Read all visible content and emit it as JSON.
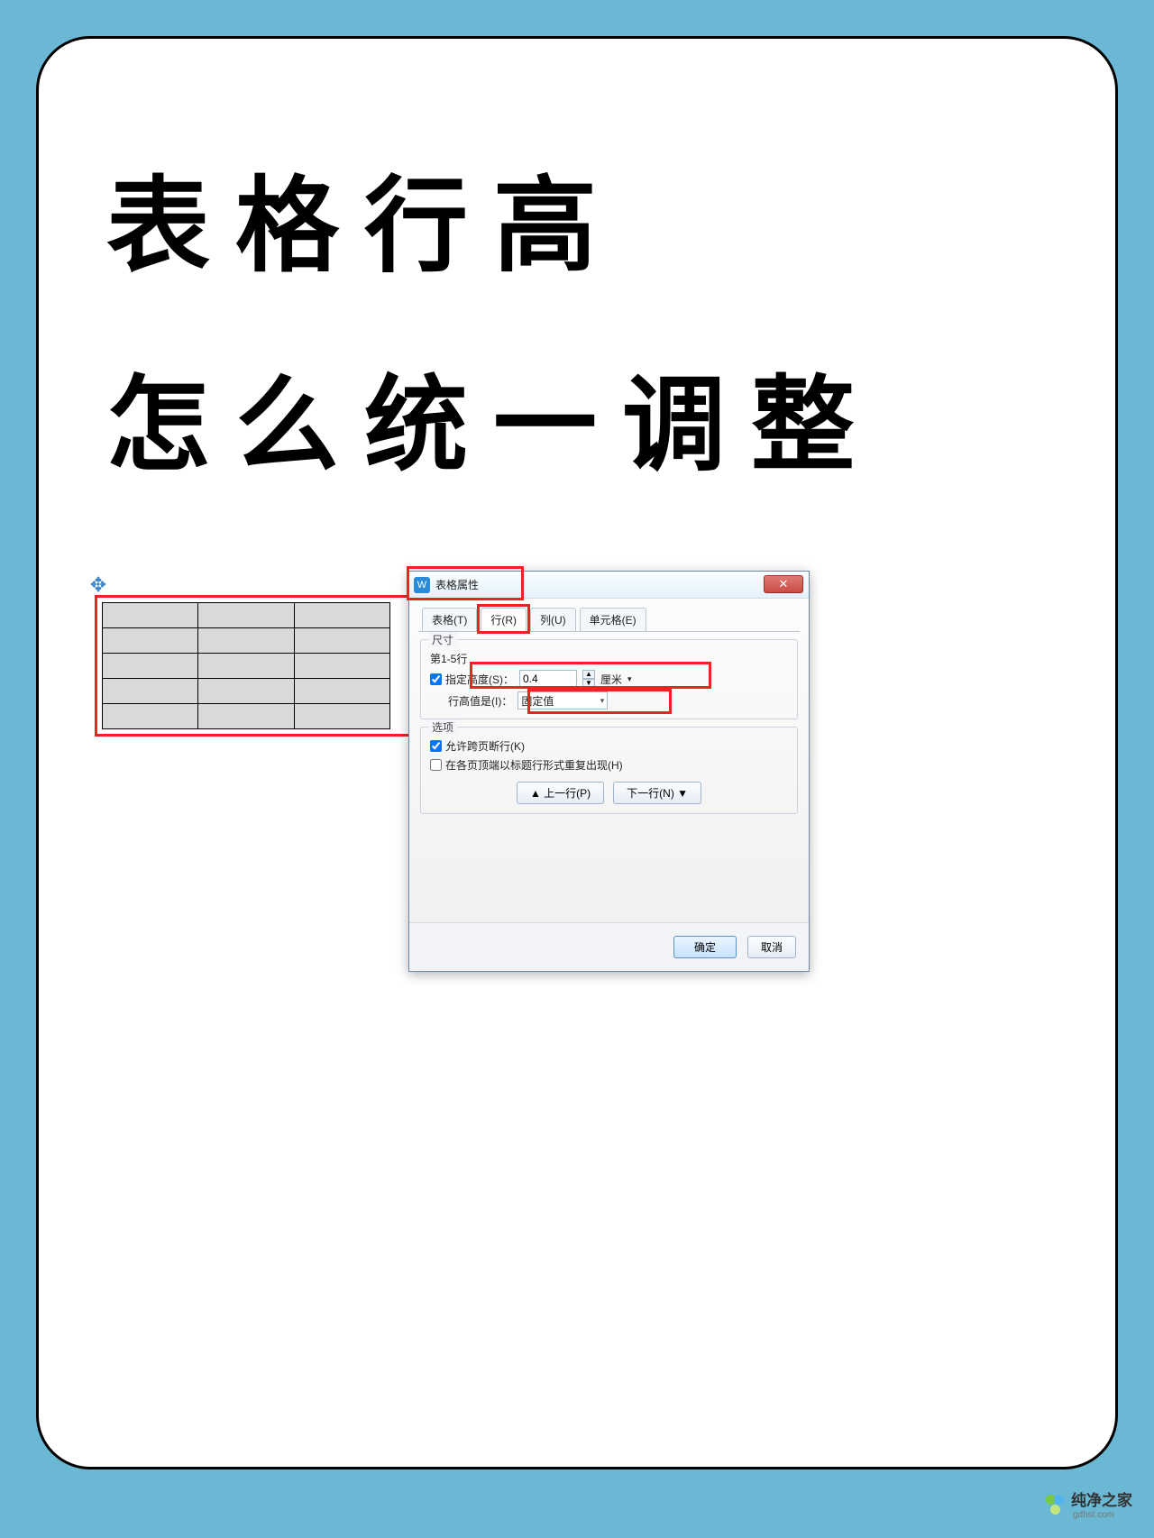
{
  "title": {
    "line1": "表格行高",
    "line2": "怎么统一调整"
  },
  "dialog": {
    "title": "表格属性",
    "close": "✕",
    "tabs": {
      "table": "表格(T)",
      "row": "行(R)",
      "column": "列(U)",
      "cell": "单元格(E)"
    },
    "size": {
      "group": "尺寸",
      "range": "第1-5行",
      "specify_label": "指定高度(S)：",
      "height_value": "0.4",
      "unit": "厘米",
      "row_type_label": "行高值是(I)：",
      "row_type_value": "固定值"
    },
    "options": {
      "group": "选项",
      "break_label": "允许跨页断行(K)",
      "repeat_label": "在各页顶端以标题行形式重复出现(H)"
    },
    "nav": {
      "prev": "▲ 上一行(P)",
      "next": "下一行(N) ▼"
    },
    "footer": {
      "ok": "确定",
      "cancel": "取消"
    }
  },
  "watermark": {
    "brand": "纯净之家",
    "url": "gdhst.com"
  }
}
